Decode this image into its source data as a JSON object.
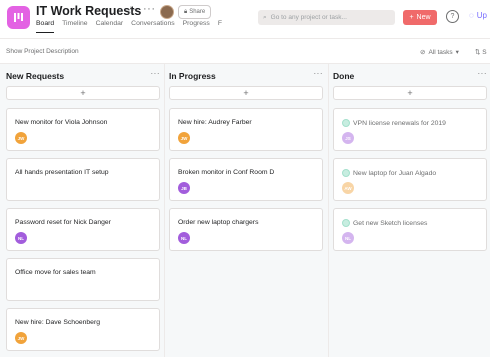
{
  "header": {
    "title": "IT Work Requests",
    "share_label": "Share",
    "tabs": [
      "Board",
      "Timeline",
      "Calendar",
      "Conversations",
      "Progress",
      "F"
    ],
    "search_placeholder": "Go to any project or task...",
    "new_label": "New",
    "help_label": "?",
    "upgrade_label": "Up"
  },
  "toolbar": {
    "show_description": "Show Project Description",
    "all_tasks": "All tasks",
    "sort": "S"
  },
  "colors": {
    "accent": "#e362e3",
    "new_button": "#f06a6a",
    "upgrade": "#796eff"
  },
  "columns": [
    {
      "title": "New Requests",
      "more": "···",
      "add": "+",
      "cards": [
        {
          "name": "New monitor for Viola Johnson",
          "initials": "JW",
          "color": "#f1a33b"
        },
        {
          "name": "All hands presentation IT setup",
          "initials": "",
          "color": ""
        },
        {
          "name": "Password reset for Nick Danger",
          "initials": "NL",
          "color": "#a25ddc"
        },
        {
          "name": "Office move for sales team",
          "initials": "",
          "color": ""
        },
        {
          "name": "New hire: Dave Schoenberg",
          "initials": "JW",
          "color": "#f1a33b"
        }
      ]
    },
    {
      "title": "In Progress",
      "more": "···",
      "add": "+",
      "cards": [
        {
          "name": "New hire: Audrey Farber",
          "initials": "JW",
          "color": "#f1a33b"
        },
        {
          "name": "Broken monitor in Conf Room D",
          "initials": "JB",
          "color": "#a25ddc"
        },
        {
          "name": "Order new laptop chargers",
          "initials": "NL",
          "color": "#a25ddc"
        }
      ]
    },
    {
      "title": "Done",
      "more": "···",
      "add": "+",
      "cards": [
        {
          "name": "VPN license renewals for 2019",
          "initials": "JS",
          "color": "#a25ddc"
        },
        {
          "name": "New laptop for Juan Algado",
          "initials": "AW",
          "color": "#f1a33b"
        },
        {
          "name": "Get new Sketch licenses",
          "initials": "NL",
          "color": "#a25ddc"
        }
      ]
    }
  ]
}
